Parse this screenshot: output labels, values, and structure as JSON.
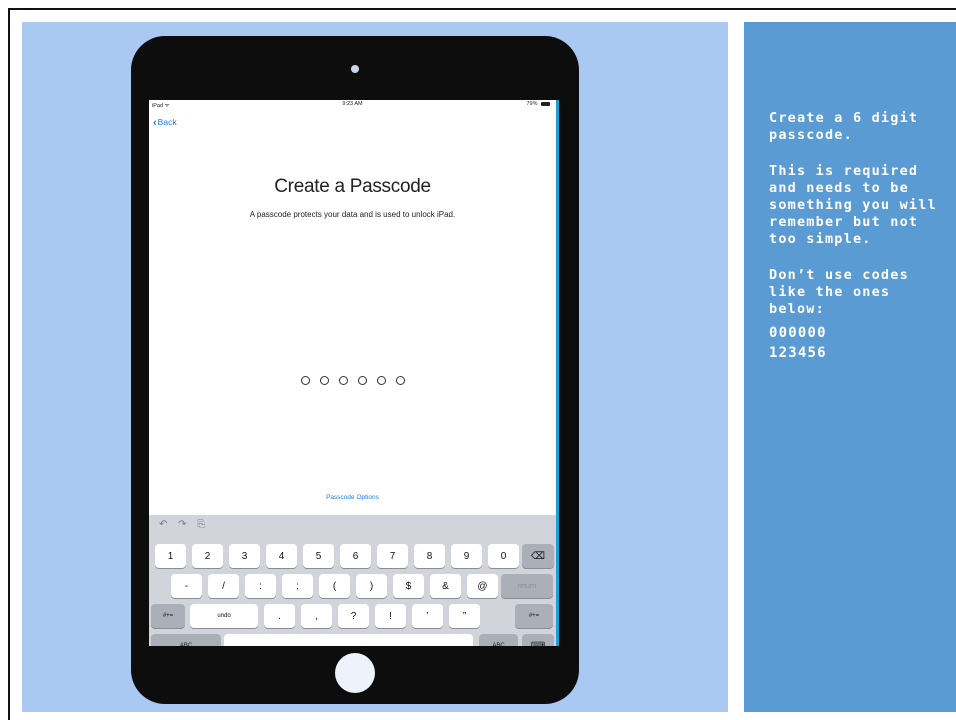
{
  "device": {
    "status_bar": {
      "carrier": "iPad ᯤ",
      "time": "9:23 AM",
      "battery": "79%"
    },
    "back_label": "Back",
    "title": "Create a Passcode",
    "subtitle": "A passcode protects your data and is used to unlock iPad.",
    "passcode_length": 6,
    "options_label": "Passcode Options",
    "keyboard": {
      "tools": [
        "↶",
        "↷",
        "⎘"
      ],
      "row1": [
        "1",
        "2",
        "3",
        "4",
        "5",
        "6",
        "7",
        "8",
        "9",
        "0",
        "⌫"
      ],
      "row2": [
        "-",
        "/",
        ":",
        ";",
        "(",
        ")",
        "$",
        "&",
        "@",
        "return"
      ],
      "row3": [
        "#+=",
        "undo",
        ".",
        ",",
        "?",
        "!",
        "’",
        "”",
        "#+="
      ],
      "row4": [
        "ABC",
        "",
        "ABC",
        "⌨"
      ]
    }
  },
  "instructions": {
    "p1": "Create a 6 digit passcode.",
    "p2": "This is required and needs to be something you will remember but not too simple.",
    "p3": "Don’t use codes like the ones below:",
    "codes": [
      "000000",
      "123456"
    ]
  }
}
